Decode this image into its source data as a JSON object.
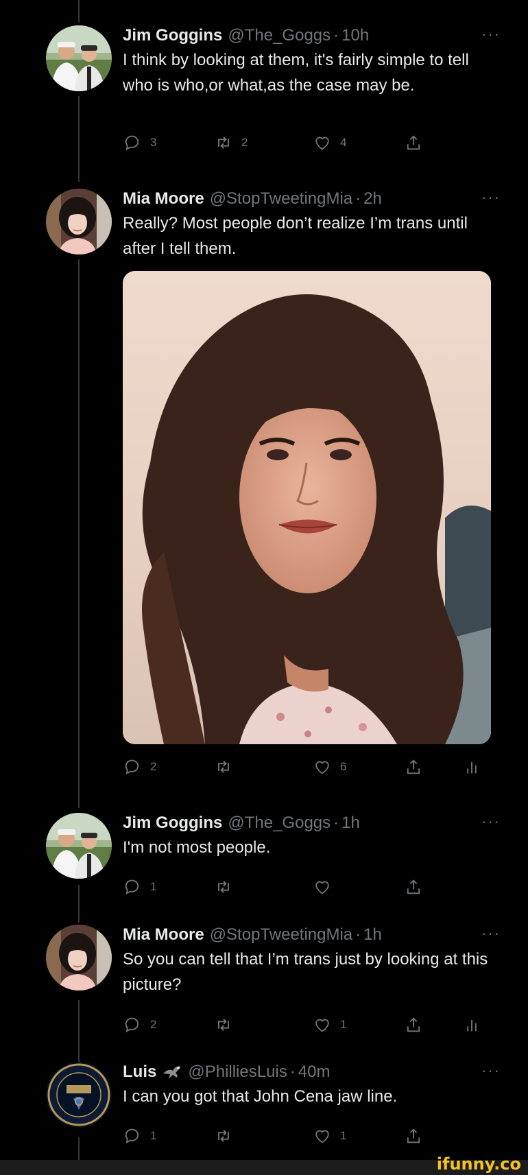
{
  "tweets": [
    {
      "name": "Jim Goggins",
      "handle": "@The_Goggs",
      "time": "10h",
      "text": "I think by looking at them, it's fairly simple to tell who is who,or what,as the case may be.",
      "reply_count": "3",
      "retweet_count": "2",
      "like_count": "4",
      "avatar_icon": "avatar-two-men-golf"
    },
    {
      "name": "Mia Moore",
      "handle": "@StopTweetingMia",
      "time": "2h",
      "text": "Really? Most people don’t realize I’m trans until after I tell them.",
      "reply_count": "2",
      "retweet_count": "",
      "like_count": "6",
      "avatar_icon": "avatar-dark-haired-woman",
      "media_alt": "photo-woman-curly-hair"
    },
    {
      "name": "Jim Goggins",
      "handle": "@The_Goggs",
      "time": "1h",
      "text": "I'm not most people.",
      "reply_count": "1",
      "retweet_count": "",
      "like_count": "",
      "avatar_icon": "avatar-two-men-golf"
    },
    {
      "name": "Mia Moore",
      "handle": "@StopTweetingMia",
      "time": "1h",
      "text": "So you can tell that I’m trans just by looking at this picture?",
      "reply_count": "2",
      "retweet_count": "",
      "like_count": "1",
      "avatar_icon": "avatar-dark-haired-woman"
    },
    {
      "name": "Luis",
      "name_emoji": "eagle-emoji",
      "handle": "@PhilliesLuis",
      "time": "40m",
      "text": "I can you got that John Cena jaw line.",
      "reply_count": "1",
      "retweet_count": "",
      "like_count": "1",
      "avatar_icon": "philadelphia-union-crest",
      "avatar_text_top": "PHILADELPHIA",
      "avatar_text_mid": "UNION"
    }
  ],
  "separator": "·",
  "more_label": "···",
  "watermark": "ifunny.co",
  "colors": {
    "background": "#000000",
    "primary_text": "#e7e9ea",
    "secondary_text": "#71767b",
    "thread_line": "#333639",
    "watermark": "#f3c223"
  }
}
